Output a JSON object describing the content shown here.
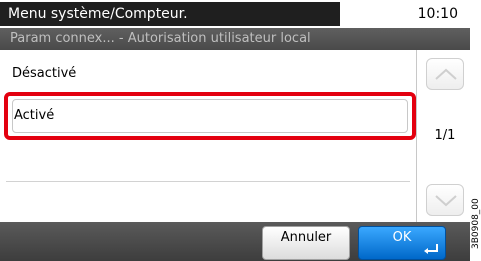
{
  "header": {
    "title": "Menu système/Compteur.",
    "time": "10:10",
    "breadcrumb": "Param connex... - Autorisation utilisateur local"
  },
  "list": {
    "items": [
      {
        "label": "Désactivé"
      },
      {
        "label": "Activé"
      },
      {
        "label": ""
      },
      {
        "label": ""
      }
    ]
  },
  "scroll": {
    "page_indicator": "1/1",
    "up_icon": "chevron-up-icon",
    "down_icon": "chevron-down-icon"
  },
  "footer": {
    "cancel_label": "Annuler",
    "ok_label": "OK",
    "enter_icon": "enter-return-icon"
  },
  "side_code": "3B0908_00",
  "colors": {
    "highlight": "#e3000f",
    "ok_button": "#0a7fe6",
    "header_dark": "#1f1f1f"
  }
}
